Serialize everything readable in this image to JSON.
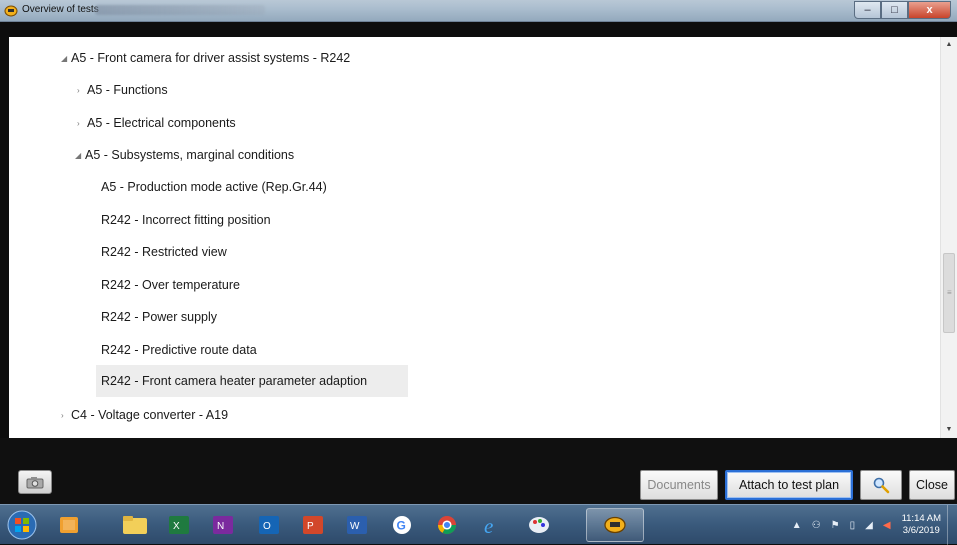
{
  "window": {
    "title": "Overview of tests",
    "controls": {
      "minimize": "–",
      "maximize": "□",
      "close": "x"
    }
  },
  "tree": {
    "items": [
      {
        "label": "A5 - Front camera for driver assist systems - R242",
        "toggle": "expanded"
      },
      {
        "label": "A5 - Functions",
        "toggle": "collapsed"
      },
      {
        "label": "A5 - Electrical components",
        "toggle": "collapsed"
      },
      {
        "label": "A5 - Subsystems, marginal conditions",
        "toggle": "expanded"
      },
      {
        "label": "A5 - Production mode active (Rep.Gr.44)",
        "toggle": "none"
      },
      {
        "label": "R242 - Incorrect fitting position",
        "toggle": "none"
      },
      {
        "label": "R242 - Restricted view",
        "toggle": "none"
      },
      {
        "label": "R242 - Over temperature",
        "toggle": "none"
      },
      {
        "label": "R242 - Power supply",
        "toggle": "none"
      },
      {
        "label": "R242 - Predictive route data",
        "toggle": "none"
      },
      {
        "label": "R242 - Front camera heater parameter adaption",
        "toggle": "none",
        "selected": true
      },
      {
        "label": "C4 - Voltage converter - A19",
        "toggle": "collapsed"
      }
    ],
    "toggle_glyphs": {
      "expanded": "◢",
      "collapsed": "›"
    }
  },
  "buttons": {
    "documents": "Documents",
    "attach": "Attach to test plan",
    "close": "Close"
  },
  "taskbar": {
    "apps": [
      "start-orb-icon",
      "outlook-icon",
      "file-explorer-icon",
      "excel-icon",
      "onenote-icon",
      "outlook-mail-icon",
      "powerpoint-icon",
      "word-icon",
      "google-icon",
      "chrome-icon",
      "internet-explorer-icon",
      "paint-icon",
      "diagnostic-app-icon"
    ],
    "clock": {
      "time": "11:14 AM",
      "date": "3/6/2019"
    }
  },
  "colors": {
    "selection": "#ededed",
    "accent_border": "#2b6fd6",
    "taskbar": "#3a5a7c"
  }
}
